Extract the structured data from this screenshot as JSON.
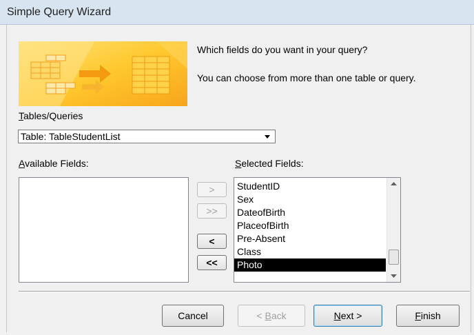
{
  "window": {
    "title": "Simple Query Wizard"
  },
  "header": {
    "prompt_main": "Which fields do you want in your query?",
    "prompt_sub": "You can choose from more than one table or query."
  },
  "tables_queries": {
    "label_hotkey": "T",
    "label_rest": "ables/Queries",
    "selected": "Table: TableStudentList"
  },
  "available": {
    "label_hotkey": "A",
    "label_rest": "vailable Fields:",
    "items": []
  },
  "selected_fields": {
    "label_hotkey": "S",
    "label_rest": "elected Fields:",
    "items": [
      "StudentID",
      "Sex",
      "DateofBirth",
      "PlaceofBirth",
      "Pre-Absent",
      "Class",
      "Photo"
    ],
    "selected_item": "Photo"
  },
  "move_buttons": {
    "add_one": ">",
    "add_all": ">>",
    "remove_one": "<",
    "remove_all": "<<"
  },
  "footer": {
    "cancel": "Cancel",
    "back_prefix": "< ",
    "back_hotkey": "B",
    "back_rest": "ack",
    "next_hotkey": "N",
    "next_rest": "ext >",
    "finish_hotkey": "F",
    "finish_rest": "inish"
  },
  "colors": {
    "banner_orange": "#f5a81c",
    "banner_yellow": "#ffd84a",
    "selection_bg": "#000000"
  }
}
